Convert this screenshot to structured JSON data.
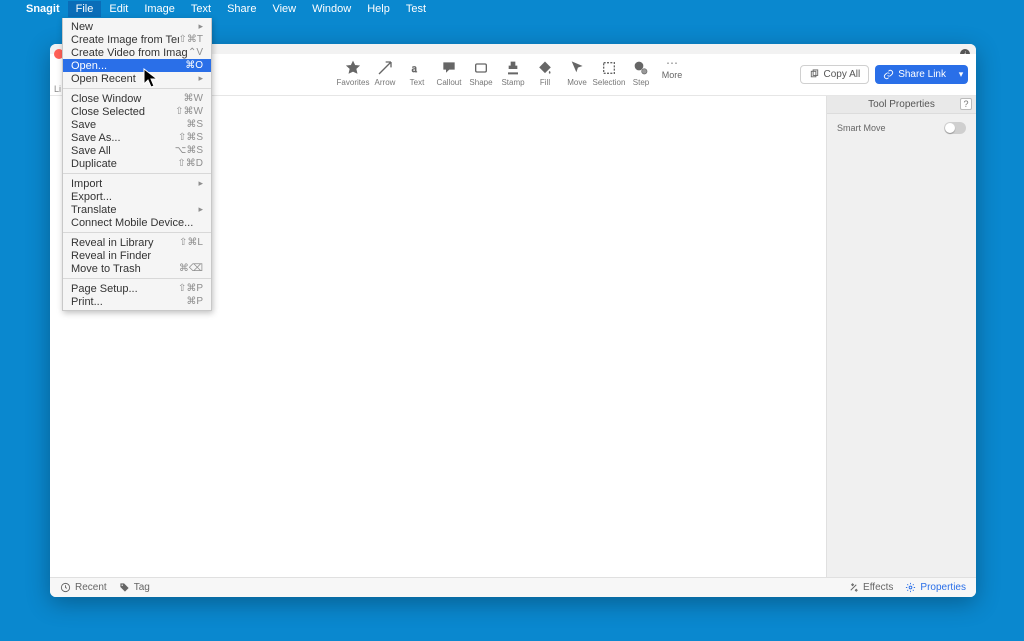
{
  "menubar": {
    "app": "Snagit",
    "items": [
      "File",
      "Edit",
      "Image",
      "Text",
      "Share",
      "View",
      "Window",
      "Help",
      "Test"
    ],
    "active_index": 0
  },
  "dropdown": {
    "groups": [
      [
        {
          "label": "New",
          "submenu": true
        },
        {
          "label": "Create Image from Template...",
          "shortcut": "⇧⌘T"
        },
        {
          "label": "Create Video from Images...",
          "shortcut": "⌃V"
        },
        {
          "label": "Open...",
          "shortcut": "⌘O",
          "selected": true
        },
        {
          "label": "Open Recent",
          "submenu": true
        }
      ],
      [
        {
          "label": "Close Window",
          "shortcut": "⌘W"
        },
        {
          "label": "Close Selected",
          "shortcut": "⇧⌘W"
        },
        {
          "label": "Save",
          "shortcut": "⌘S"
        },
        {
          "label": "Save As...",
          "shortcut": "⇧⌘S"
        },
        {
          "label": "Save All",
          "shortcut": "⌥⌘S"
        },
        {
          "label": "Duplicate",
          "shortcut": "⇧⌘D"
        }
      ],
      [
        {
          "label": "Import",
          "submenu": true
        },
        {
          "label": "Export..."
        },
        {
          "label": "Translate",
          "submenu": true
        },
        {
          "label": "Connect Mobile Device..."
        }
      ],
      [
        {
          "label": "Reveal in Library",
          "shortcut": "⇧⌘L"
        },
        {
          "label": "Reveal in Finder"
        },
        {
          "label": "Move to Trash",
          "shortcut": "⌘⌫"
        }
      ],
      [
        {
          "label": "Page Setup...",
          "shortcut": "⇧⌘P"
        },
        {
          "label": "Print...",
          "shortcut": "⌘P"
        }
      ]
    ]
  },
  "toolbar": {
    "tools": [
      {
        "name": "favorites",
        "label": "Favorites"
      },
      {
        "name": "arrow",
        "label": "Arrow"
      },
      {
        "name": "text",
        "label": "Text"
      },
      {
        "name": "callout",
        "label": "Callout"
      },
      {
        "name": "shape",
        "label": "Shape"
      },
      {
        "name": "stamp",
        "label": "Stamp"
      },
      {
        "name": "fill",
        "label": "Fill"
      },
      {
        "name": "move",
        "label": "Move"
      },
      {
        "name": "selection",
        "label": "Selection"
      },
      {
        "name": "step",
        "label": "Step"
      }
    ],
    "more": "More",
    "copy_all": "Copy All",
    "share_link": "Share Link"
  },
  "library_label": "Li",
  "sidepanel": {
    "title": "Tool Properties",
    "help": "?",
    "smart_move": "Smart Move"
  },
  "footer": {
    "recent": "Recent",
    "tag": "Tag",
    "effects": "Effects",
    "properties": "Properties"
  }
}
